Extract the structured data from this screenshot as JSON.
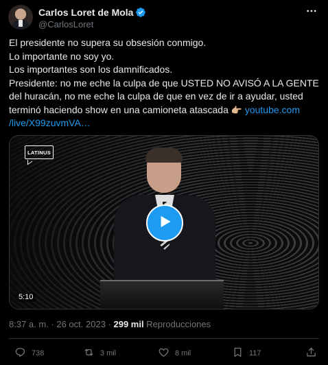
{
  "author": {
    "display_name": "Carlos Loret de Mola",
    "handle": "@CarlosLoret"
  },
  "tweet": {
    "lines": [
      "El presidente no supera su obsesión conmigo.",
      "Lo importante no soy yo.",
      "Los importantes son los damnificados.",
      "Presidente: no me eche la culpa de que USTED NO AVISÓ A LA GENTE",
      "del huracán, no me eche la culpa de que en vez de ir a ayudar, usted",
      "terminó haciendo show en una camioneta atascada"
    ],
    "emoji": "👉🏼",
    "link_part1": "youtube.com",
    "link_part2": "/live/X99zuvmVA…"
  },
  "media": {
    "watermark": "LATINUS",
    "duration": "5:10"
  },
  "meta": {
    "timestamp": "8:37 a. m. · 26 oct. 2023 · ",
    "views_count": "299 mil",
    "views_label": " Reproducciones"
  },
  "actions": {
    "replies": "738",
    "reposts": "3 mil",
    "likes": "8 mil",
    "bookmarks": "117"
  },
  "colors": {
    "accent": "#1d9bf0",
    "muted": "#71767b",
    "text": "#e7e9ea",
    "background": "#000000"
  }
}
